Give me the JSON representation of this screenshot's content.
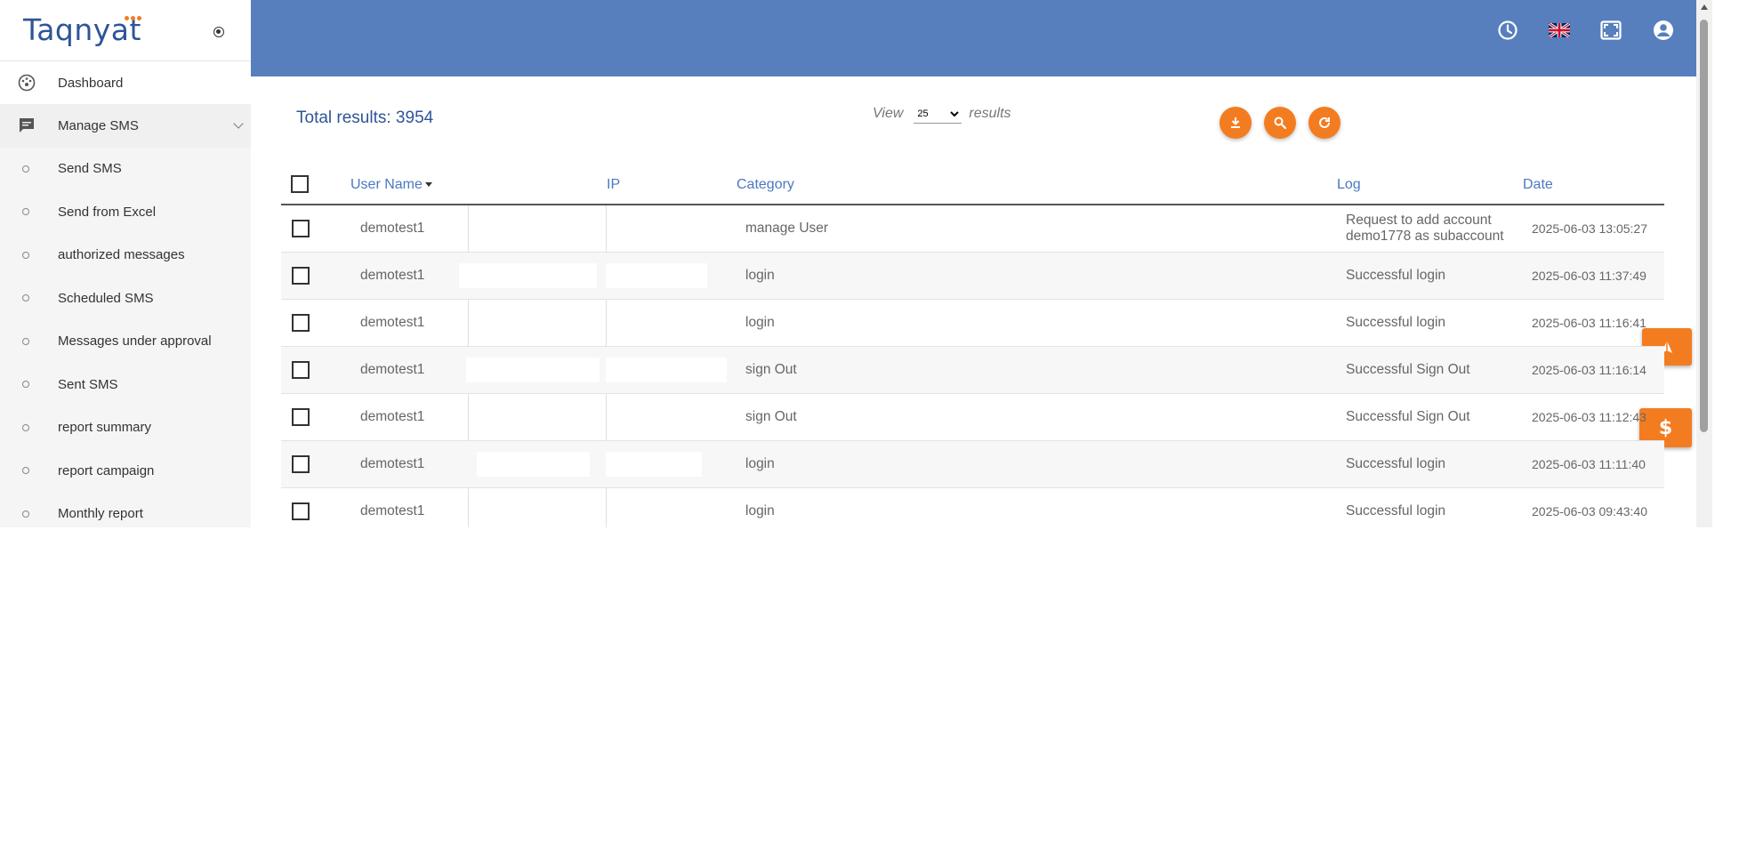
{
  "brand": {
    "name": "Taqnyat"
  },
  "sidebar": {
    "items": [
      {
        "label": "Dashboard",
        "icon": "dashboard-icon"
      },
      {
        "label": "Manage SMS",
        "icon": "message-icon"
      },
      {
        "label": "Send SMS"
      },
      {
        "label": "Send from Excel"
      },
      {
        "label": "authorized messages"
      },
      {
        "label": "Scheduled SMS"
      },
      {
        "label": "Messages under approval"
      },
      {
        "label": "Sent SMS"
      },
      {
        "label": "report summary"
      },
      {
        "label": "report campaign"
      },
      {
        "label": "Monthly report"
      }
    ]
  },
  "header": {
    "icons": [
      "history-icon",
      "uk-flag-icon",
      "fullscreen-icon",
      "account-icon"
    ],
    "accent": "#577fbd"
  },
  "results": {
    "total_label": "Total results: 3954",
    "view_prefix": "View",
    "view_suffix": "results",
    "page_size": "25",
    "page_size_options": [
      "25"
    ]
  },
  "actions": [
    "download-icon",
    "search-icon",
    "refresh-icon"
  ],
  "accent_orange": "#f47c20",
  "table": {
    "columns": [
      "User Name",
      "IP",
      "Category",
      "Log",
      "Date"
    ],
    "rows": [
      {
        "user": "demotest1",
        "category": "manage User",
        "log": "Request to add account demo1778 as subaccount",
        "date": "2025-06-03 13:05:27"
      },
      {
        "user": "demotest1",
        "category": "login",
        "log": "Successful login",
        "date": "2025-06-03 11:37:49"
      },
      {
        "user": "demotest1",
        "category": "login",
        "log": "Successful login",
        "date": "2025-06-03 11:16:41"
      },
      {
        "user": "demotest1",
        "category": "sign Out",
        "log": "Successful Sign Out",
        "date": "2025-06-03 11:16:14"
      },
      {
        "user": "demotest1",
        "category": "sign Out",
        "log": "Successful Sign Out",
        "date": "2025-06-03 11:12:43"
      },
      {
        "user": "demotest1",
        "category": "login",
        "log": "Successful login",
        "date": "2025-06-03 11:11:40"
      },
      {
        "user": "demotest1",
        "category": "login",
        "log": "Successful login",
        "date": "2025-06-03 09:43:40"
      }
    ]
  },
  "floating": [
    "navigate-icon",
    "dollar-icon"
  ]
}
